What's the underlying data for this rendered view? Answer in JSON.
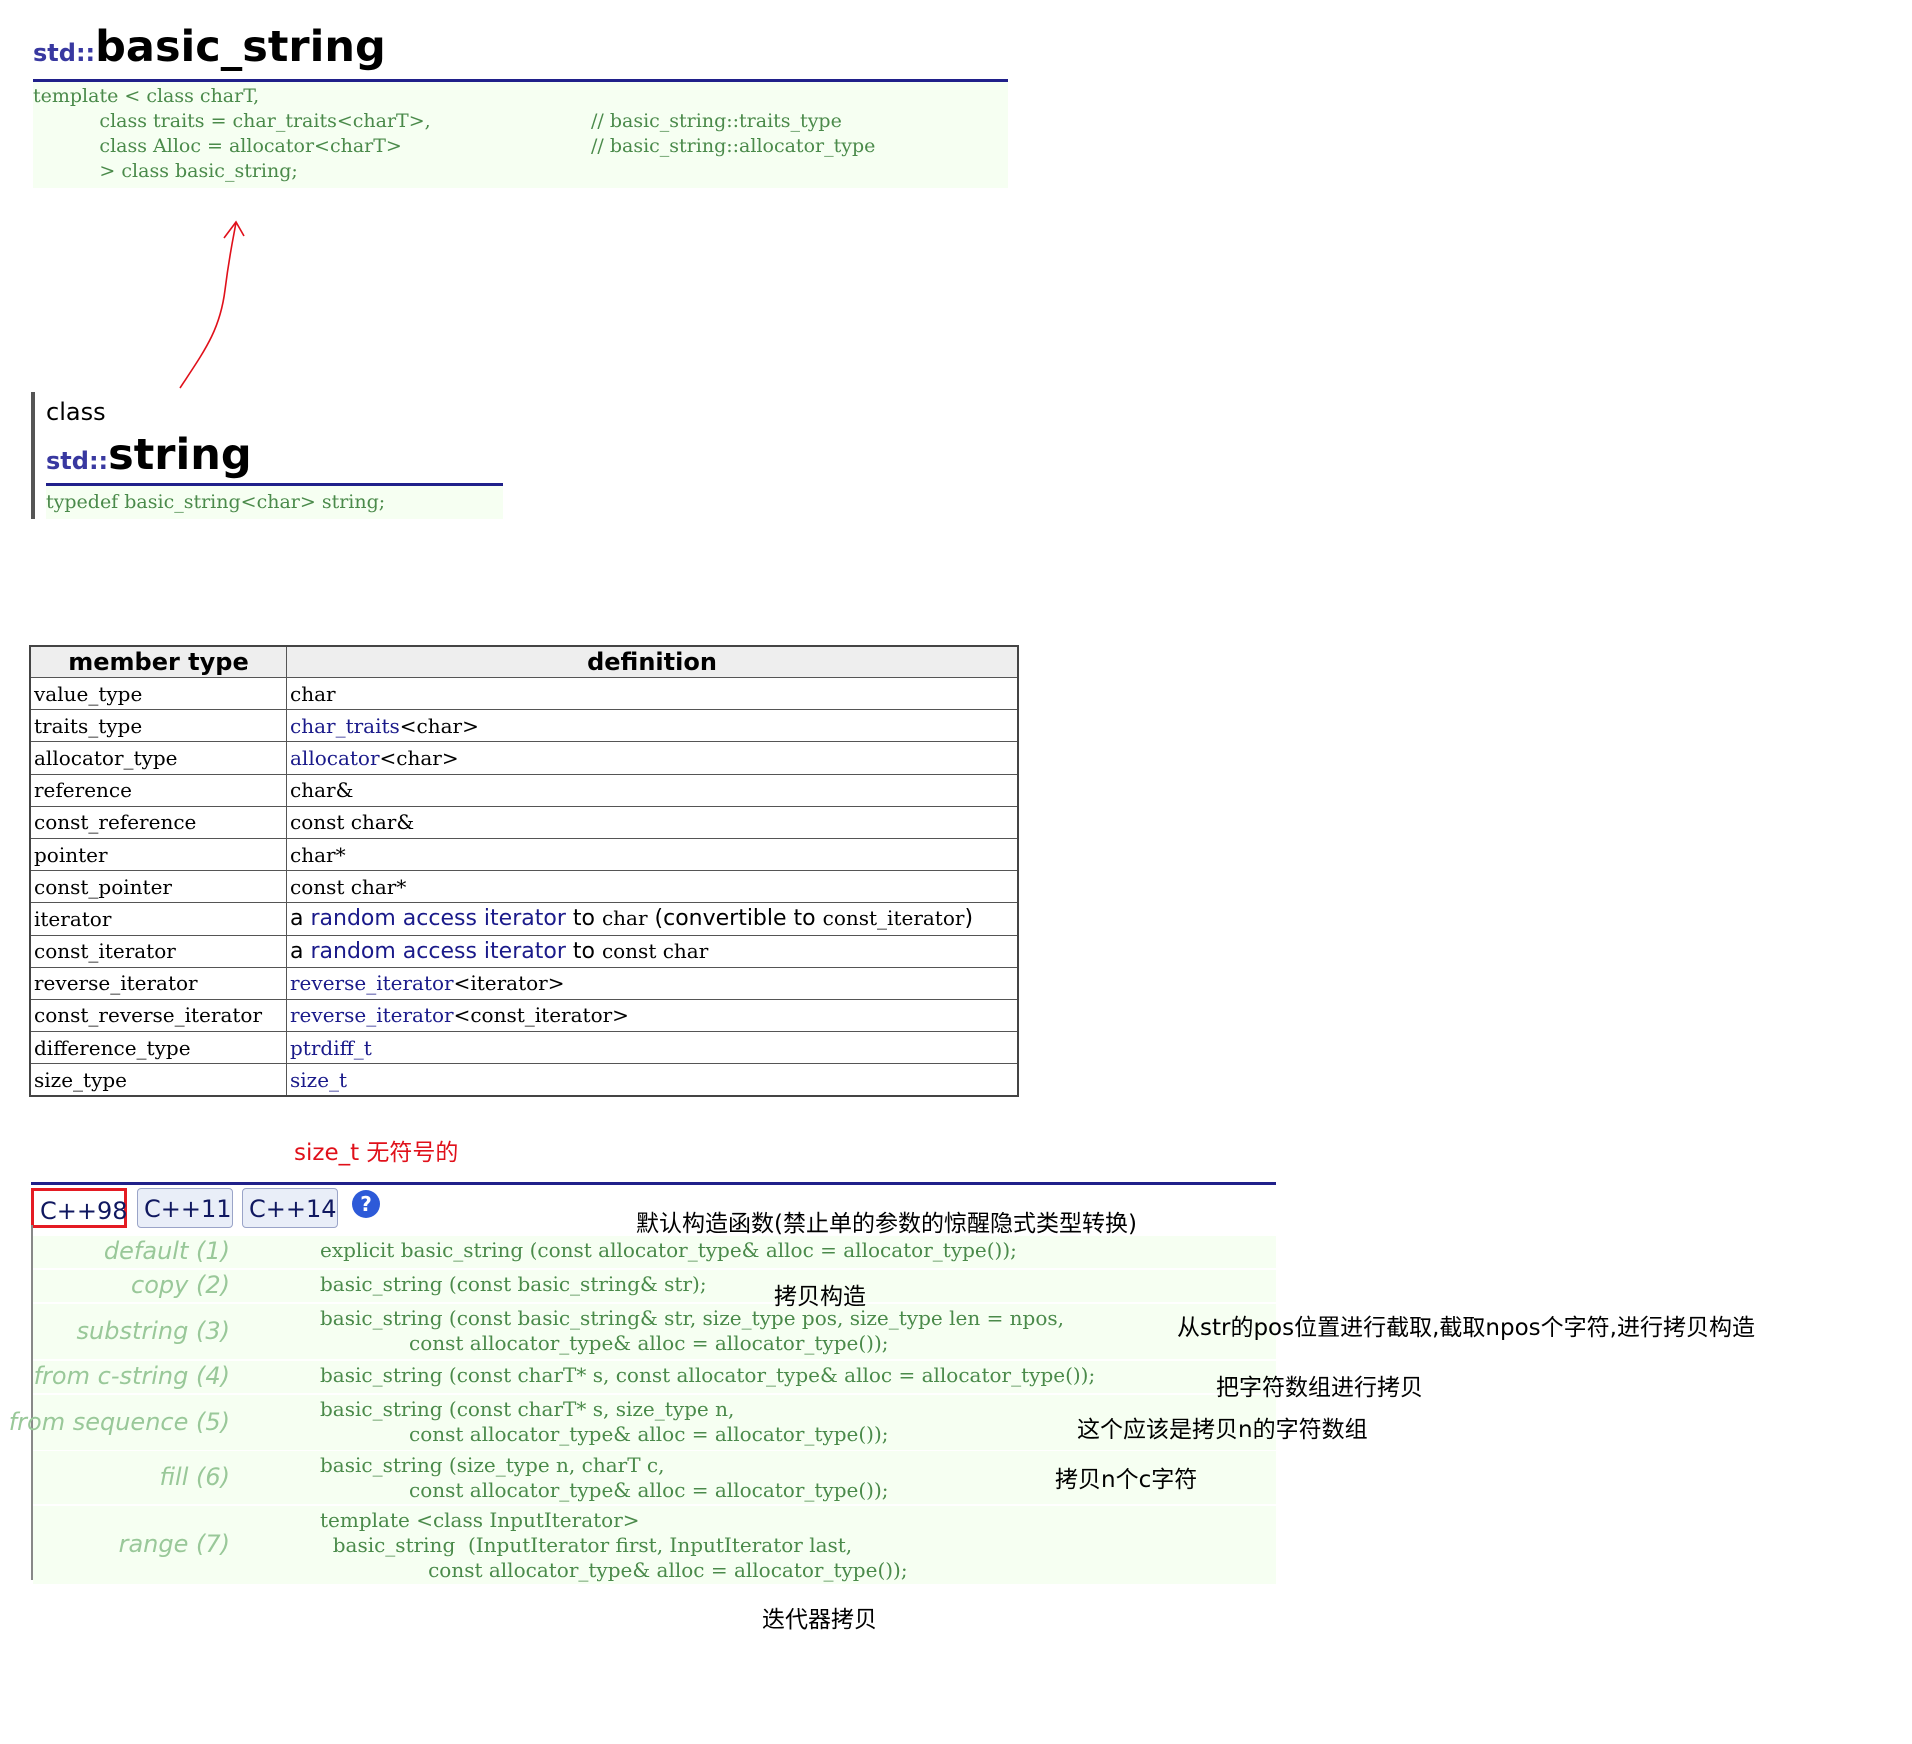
{
  "header": {
    "namespace": "std::",
    "name": "basic_string",
    "code_lines": [
      "template < class charT,",
      "           class traits = char_traits<charT>,",
      "           class Alloc = allocator<charT>",
      "           > class basic_string;"
    ],
    "comments": [
      "// basic_string::traits_type",
      "// basic_string::allocator_type"
    ]
  },
  "string_section": {
    "class_label": "class",
    "namespace": "std::",
    "name": "string",
    "typedef": "typedef basic_string<char> string;"
  },
  "member_table": {
    "headers": [
      "member type",
      "definition"
    ],
    "rows": [
      {
        "type": "value_type",
        "def": "char"
      },
      {
        "type": "traits_type",
        "def_link": "char_traits",
        "def_rest": "<char>"
      },
      {
        "type": "allocator_type",
        "def_link": "allocator",
        "def_rest": "<char>"
      },
      {
        "type": "reference",
        "def": "char&"
      },
      {
        "type": "const_reference",
        "def": "const char&"
      },
      {
        "type": "pointer",
        "def": "char*"
      },
      {
        "type": "const_pointer",
        "def": "const char*"
      },
      {
        "type": "iterator",
        "prefix": "a ",
        "link": "random access iterator",
        "mid": " to ",
        "code1": "char",
        "text2": " (convertible to ",
        "code2": "const_iterator",
        "text3": ")"
      },
      {
        "type": "const_iterator",
        "prefix": "a ",
        "link": "random access iterator",
        "mid": " to ",
        "code1": "const char"
      },
      {
        "type": "reverse_iterator",
        "def_link": "reverse_iterator",
        "def_rest": "<iterator>"
      },
      {
        "type": "const_reverse_iterator",
        "def_link": "reverse_iterator",
        "def_rest": "<const_iterator>"
      },
      {
        "type": "difference_type",
        "def_link": "ptrdiff_t",
        "def_rest": ""
      },
      {
        "type": "size_type",
        "def_link": "size_t",
        "def_rest": ""
      }
    ]
  },
  "annotations": {
    "size_t_note": "size_t 无符号的",
    "default_ctor": "默认构造函数(禁止单的参数的惊醒隐式类型转换)",
    "copy_ctor": "拷贝构造",
    "substring": "从str的pos位置进行截取,截取npos个字符,进行拷贝构造",
    "c_string": "把字符数组进行拷贝",
    "sequence": "这个应该是拷贝n的字符数组",
    "fill": "拷贝n个c字符",
    "range": "迭代器拷贝"
  },
  "tabs": [
    {
      "label": "C++98",
      "active": true
    },
    {
      "label": "C++11",
      "active": false
    },
    {
      "label": "C++14",
      "active": false
    }
  ],
  "help_icon": "?",
  "constructors": [
    {
      "label": "default (1)",
      "lines": [
        "explicit basic_string (const allocator_type& alloc = allocator_type());"
      ]
    },
    {
      "label": "copy (2)",
      "lines": [
        "basic_string (const basic_string& str);"
      ]
    },
    {
      "label": "substring (3)",
      "lines": [
        "basic_string (const basic_string& str, size_type pos, size_type len = npos,",
        "              const allocator_type& alloc = allocator_type());"
      ]
    },
    {
      "label": "from c-string (4)",
      "lines": [
        "basic_string (const charT* s, const allocator_type& alloc = allocator_type());"
      ]
    },
    {
      "label": "from sequence (5)",
      "lines": [
        "basic_string (const charT* s, size_type n,",
        "              const allocator_type& alloc = allocator_type());"
      ]
    },
    {
      "label": "fill (6)",
      "lines": [
        "basic_string (size_type n, charT c,",
        "              const allocator_type& alloc = allocator_type());"
      ]
    },
    {
      "label": "range (7)",
      "lines": [
        "template <class InputIterator>",
        "  basic_string  (InputIterator first, InputIterator last,",
        "                 const allocator_type& alloc = allocator_type());"
      ]
    }
  ]
}
